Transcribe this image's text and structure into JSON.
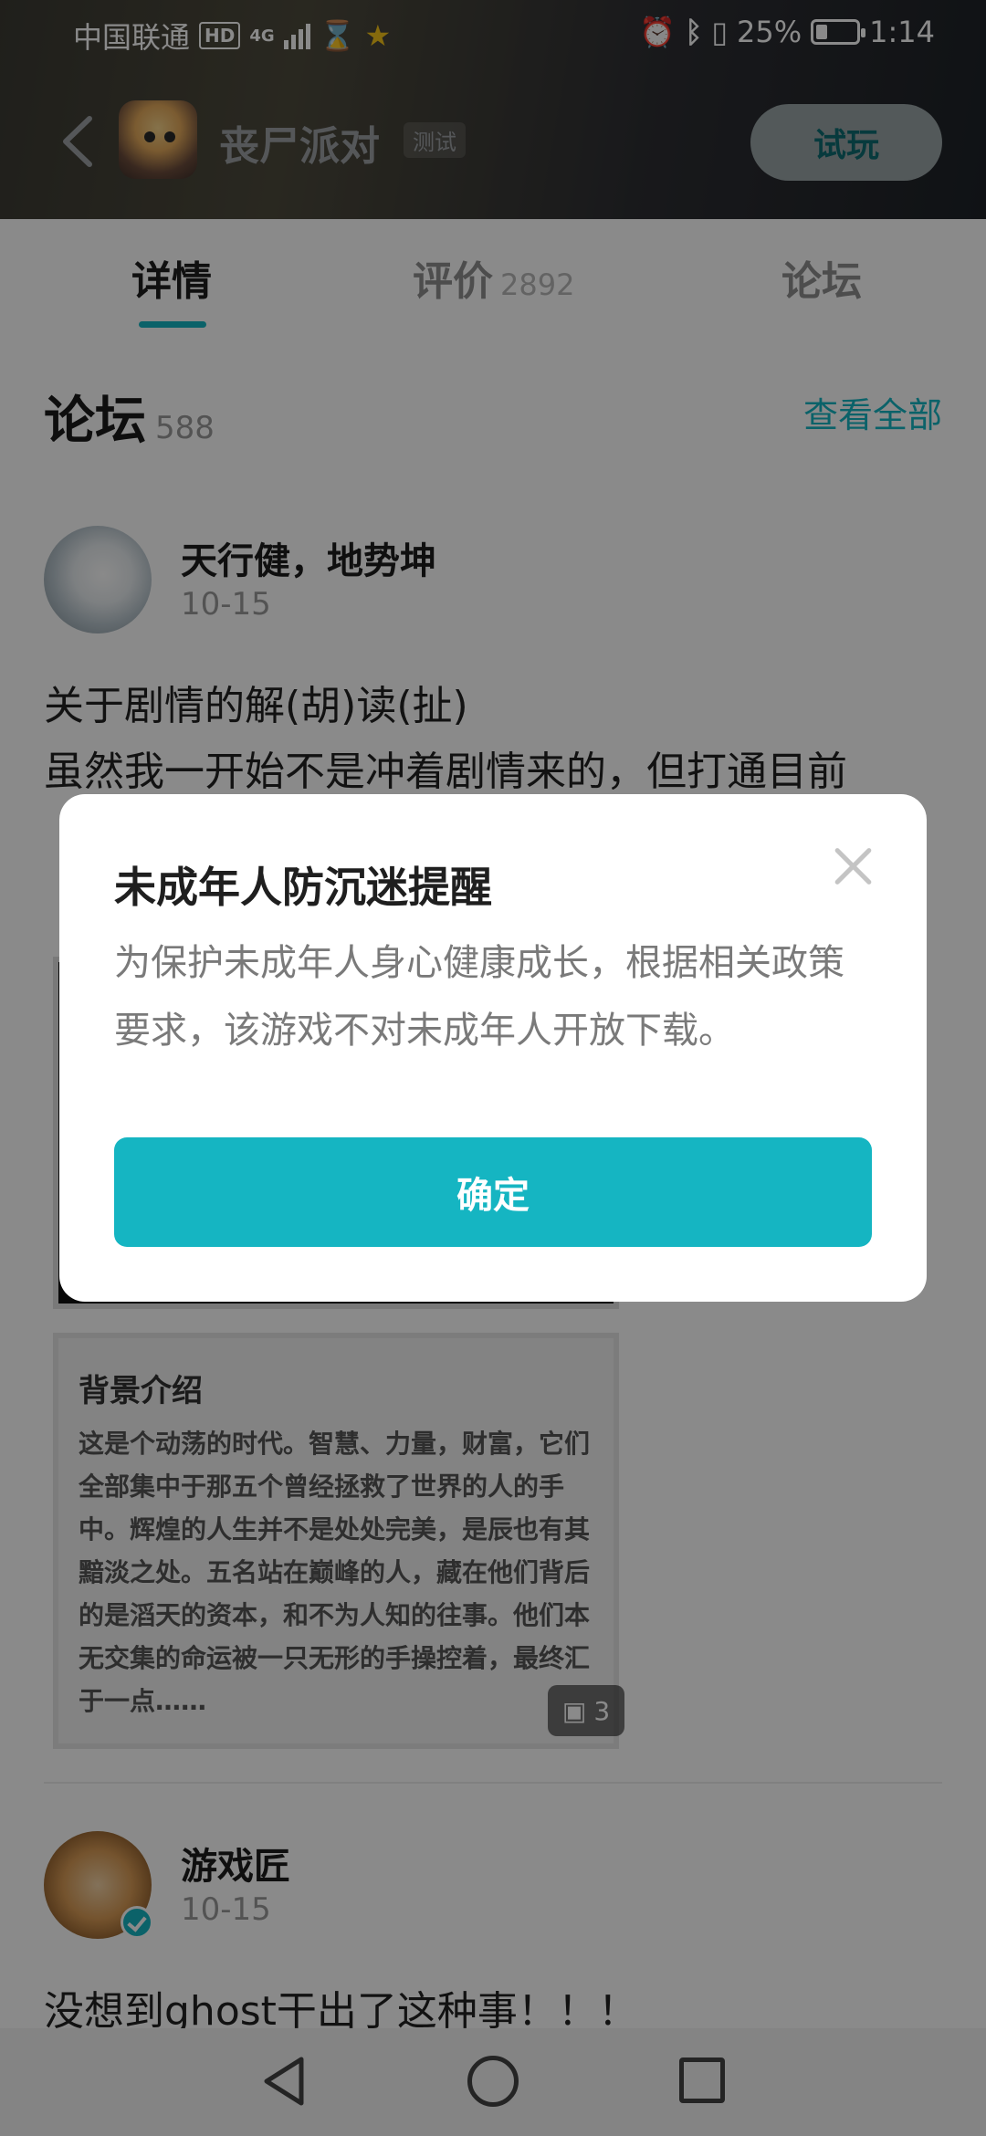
{
  "status_bar": {
    "carrier": "中国联通",
    "hd": "HD",
    "network": "4G",
    "battery": "25%",
    "time": "1:14"
  },
  "app_bar": {
    "game_title": "丧尸派对",
    "test_badge": "测试",
    "try_button": "试玩"
  },
  "tabs": [
    {
      "label": "详情"
    },
    {
      "label": "评价",
      "count": "2892"
    },
    {
      "label": "论坛"
    }
  ],
  "forum": {
    "title": "论坛",
    "count": "588",
    "view_all": "查看全部",
    "posts": [
      {
        "author": "天行健，地势坤",
        "date": "10-15",
        "text_line1": "关于剧情的解(胡)读(扯)",
        "text_line2": "虽然我一开始不是冲着剧情来的，但打通目前",
        "image_title": "背景介绍",
        "image_text": "这是个动荡的时代。智慧、力量，财富，它们全部集中于那五个曾经拯救了世界的人的手中。辉煌的人生并不是处处完美，是辰也有其黯淡之处。五名站在巅峰的人，藏在他们背后的是滔天的资本，和不为人知的往事。他们本无交集的命运被一只无形的手操控着，最终汇于一点……",
        "image_count": "3"
      },
      {
        "author": "游戏匠",
        "date": "10-15",
        "text_line1": "没想到ghost干出了这种事！！！"
      }
    ]
  },
  "dialog": {
    "title": "未成年人防沉迷提醒",
    "body": "为保护未成年人身心健康成长，根据相关政策要求，该游戏不对未成年人开放下载。",
    "confirm": "确定"
  },
  "colors": {
    "accent": "#15b5c2",
    "overlay": "rgba(0,0,0,0.46)"
  }
}
